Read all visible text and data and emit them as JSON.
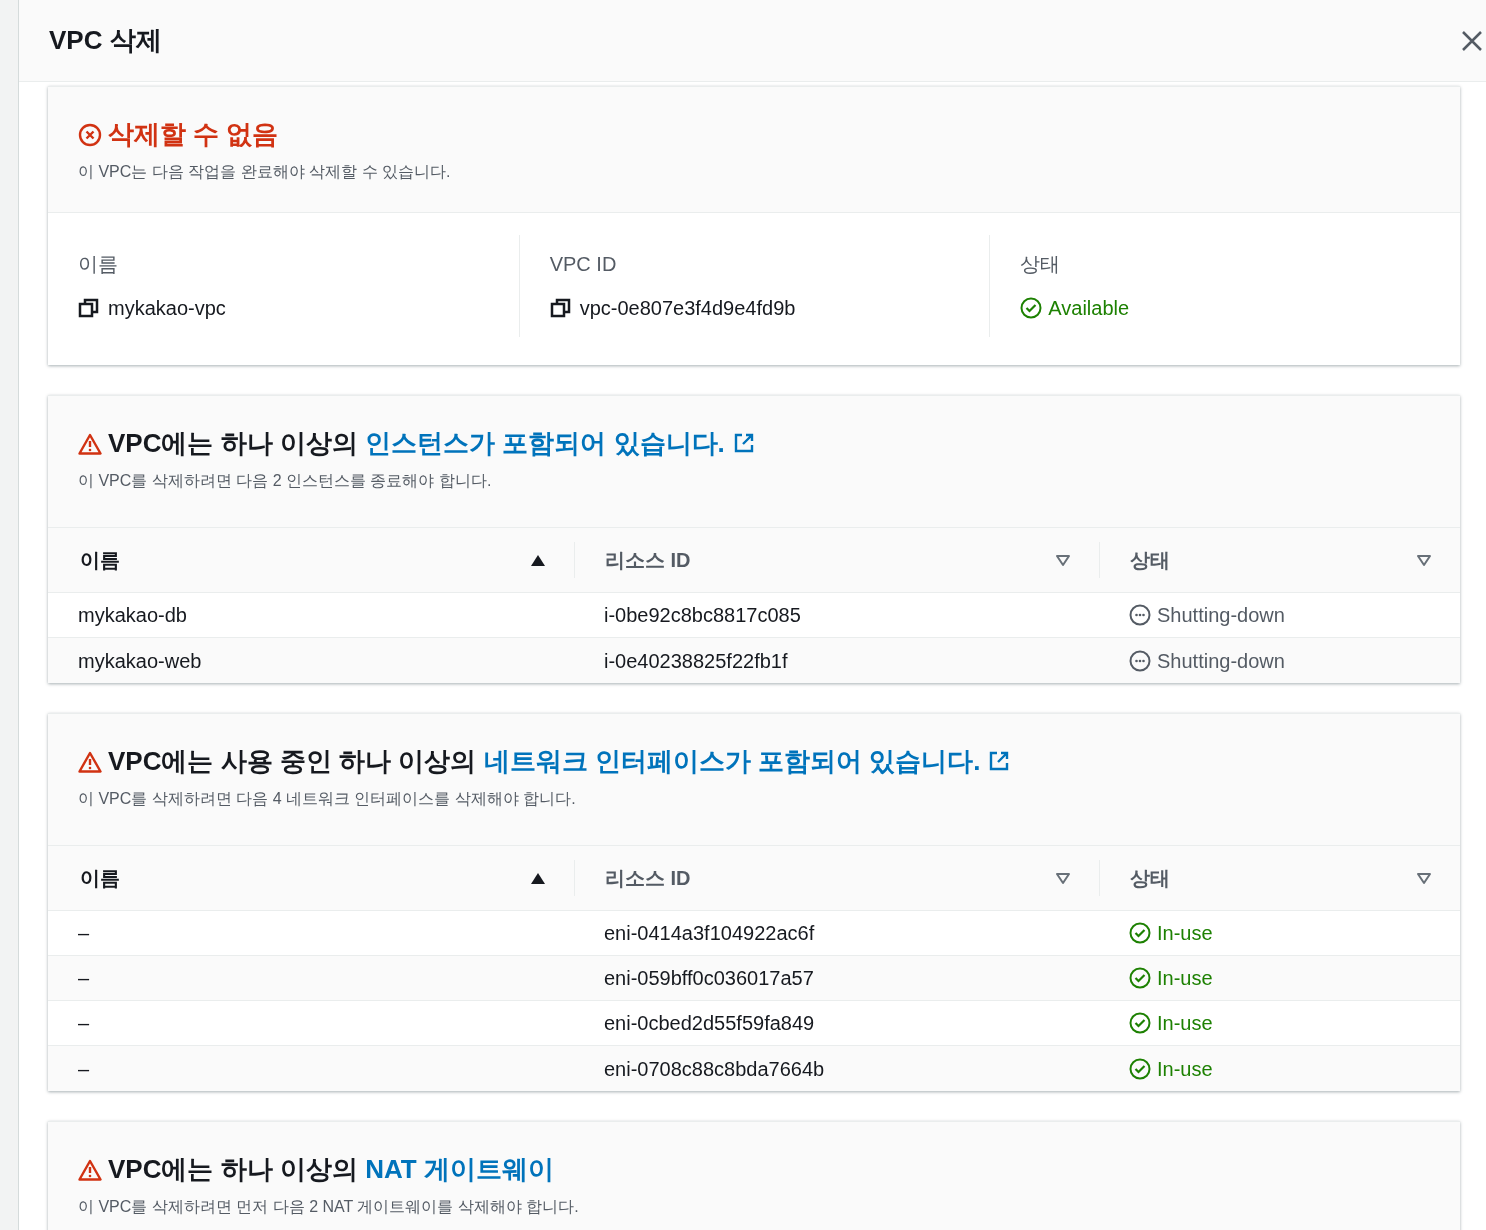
{
  "dialog": {
    "title": "VPC 삭제"
  },
  "error_card": {
    "title": "삭제할 수 없음",
    "description": "이 VPC는 다음 작업을 완료해야 삭제할 수 있습니다.",
    "details": [
      {
        "label": "이름",
        "value": "mykakao-vpc",
        "kind": "copy"
      },
      {
        "label": "VPC ID",
        "value": "vpc-0e807e3f4d9e4fd9b",
        "kind": "copy"
      },
      {
        "label": "상태",
        "value": "Available",
        "kind": "status"
      }
    ]
  },
  "dependency_sections": [
    {
      "title_prefix": "VPC에는 하나 이상의",
      "link": "인스턴스가 포함되어 있습니다.",
      "external_link": true,
      "description": "이 VPC를 삭제하려면 다음 2 인스턴스를 종료해야 합니다.",
      "table": {
        "columns": [
          {
            "label": "이름",
            "sorted": true
          },
          {
            "label": "리소스 ID",
            "sorted": false
          },
          {
            "label": "상태",
            "sorted": false
          }
        ],
        "rows": [
          {
            "name": "mykakao-db",
            "resource_id": "i-0be92c8bc8817c085",
            "status": "Shutting-down",
            "kind": "pending"
          },
          {
            "name": "mykakao-web",
            "resource_id": "i-0e40238825f22fb1f",
            "status": "Shutting-down",
            "kind": "pending"
          }
        ]
      }
    },
    {
      "title_prefix": "VPC에는 사용 중인 하나 이상의",
      "link": "네트워크 인터페이스가 포함되어 있습니다.",
      "external_link": true,
      "description": "이 VPC를 삭제하려면 다음 4 네트워크 인터페이스를 삭제해야 합니다.",
      "table": {
        "columns": [
          {
            "label": "이름",
            "sorted": true
          },
          {
            "label": "리소스 ID",
            "sorted": false
          },
          {
            "label": "상태",
            "sorted": false
          }
        ],
        "rows": [
          {
            "name": "–",
            "resource_id": "eni-0414a3f104922ac6f",
            "status": "In-use",
            "kind": "success"
          },
          {
            "name": "–",
            "resource_id": "eni-059bff0c036017a57",
            "status": "In-use",
            "kind": "success"
          },
          {
            "name": "–",
            "resource_id": "eni-0cbed2d55f59fa849",
            "status": "In-use",
            "kind": "success"
          },
          {
            "name": "–",
            "resource_id": "eni-0708c88c8bda7664b",
            "status": "In-use",
            "kind": "success"
          }
        ]
      }
    },
    {
      "title_prefix": "VPC에는 하나 이상의",
      "link": "NAT 게이트웨이",
      "external_link": false,
      "description": "이 VPC를 삭제하려면 먼저 다음 2 NAT 게이트웨이를 삭제해야 합니다."
    }
  ]
}
